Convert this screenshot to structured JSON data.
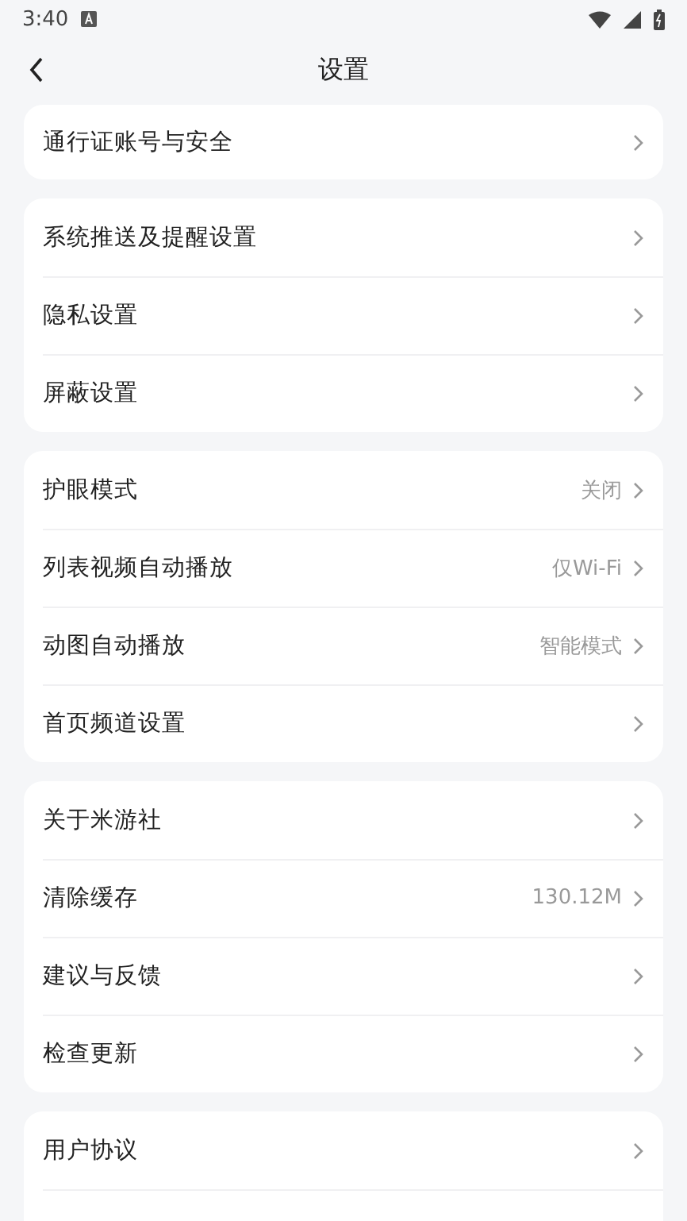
{
  "status_bar": {
    "time": "3:40"
  },
  "header": {
    "title": "设置"
  },
  "groups": [
    {
      "items": [
        {
          "label": "通行证账号与安全"
        }
      ]
    },
    {
      "items": [
        {
          "label": "系统推送及提醒设置"
        },
        {
          "label": "隐私设置"
        },
        {
          "label": "屏蔽设置"
        }
      ]
    },
    {
      "items": [
        {
          "label": "护眼模式",
          "value": "关闭"
        },
        {
          "label": "列表视频自动播放",
          "value": "仅Wi-Fi"
        },
        {
          "label": "动图自动播放",
          "value": "智能模式"
        },
        {
          "label": "首页频道设置"
        }
      ]
    },
    {
      "items": [
        {
          "label": "关于米游社"
        },
        {
          "label": "清除缓存",
          "value": "130.12M"
        },
        {
          "label": "建议与反馈"
        },
        {
          "label": "检查更新"
        }
      ]
    },
    {
      "items": [
        {
          "label": "用户协议"
        }
      ]
    }
  ]
}
